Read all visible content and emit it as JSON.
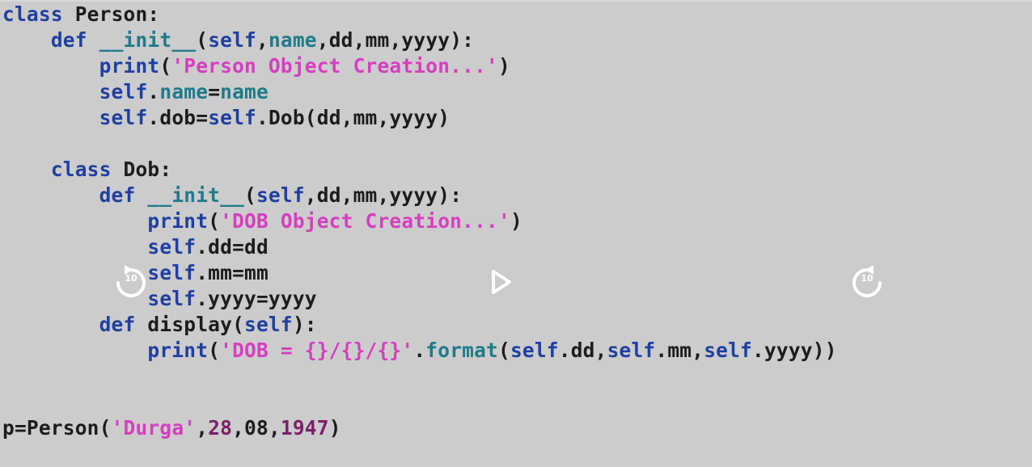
{
  "code_lines": [
    [
      {
        "t": "class",
        "c": "kw"
      },
      {
        "t": " Person:",
        "c": "plain"
      }
    ],
    [
      {
        "t": "    ",
        "c": "plain"
      },
      {
        "t": "def",
        "c": "kw"
      },
      {
        "t": " __init__",
        "c": "method"
      },
      {
        "t": "(",
        "c": "plain"
      },
      {
        "t": "self",
        "c": "selfkw"
      },
      {
        "t": ",",
        "c": "plain"
      },
      {
        "t": "name",
        "c": "attr"
      },
      {
        "t": ",dd,mm,yyyy):",
        "c": "plain"
      }
    ],
    [
      {
        "t": "        ",
        "c": "plain"
      },
      {
        "t": "print",
        "c": "selfkw"
      },
      {
        "t": "(",
        "c": "plain"
      },
      {
        "t": "'Person Object Creation...'",
        "c": "str"
      },
      {
        "t": ")",
        "c": "plain"
      }
    ],
    [
      {
        "t": "        ",
        "c": "plain"
      },
      {
        "t": "self",
        "c": "selfkw"
      },
      {
        "t": ".",
        "c": "plain"
      },
      {
        "t": "name",
        "c": "attr"
      },
      {
        "t": "=",
        "c": "plain"
      },
      {
        "t": "name",
        "c": "attr"
      }
    ],
    [
      {
        "t": "        ",
        "c": "plain"
      },
      {
        "t": "self",
        "c": "selfkw"
      },
      {
        "t": ".dob=",
        "c": "plain"
      },
      {
        "t": "self",
        "c": "selfkw"
      },
      {
        "t": ".Dob(dd,mm,yyyy)",
        "c": "plain"
      }
    ],
    [],
    [
      {
        "t": "    ",
        "c": "plain"
      },
      {
        "t": "class",
        "c": "kw"
      },
      {
        "t": " Dob:",
        "c": "plain"
      }
    ],
    [
      {
        "t": "        ",
        "c": "plain"
      },
      {
        "t": "def",
        "c": "kw"
      },
      {
        "t": " __init__",
        "c": "method"
      },
      {
        "t": "(",
        "c": "plain"
      },
      {
        "t": "self",
        "c": "selfkw"
      },
      {
        "t": ",dd,mm,yyyy):",
        "c": "plain"
      }
    ],
    [
      {
        "t": "            ",
        "c": "plain"
      },
      {
        "t": "print",
        "c": "selfkw"
      },
      {
        "t": "(",
        "c": "plain"
      },
      {
        "t": "'DOB Object Creation...'",
        "c": "str"
      },
      {
        "t": ")",
        "c": "plain"
      }
    ],
    [
      {
        "t": "            ",
        "c": "plain"
      },
      {
        "t": "self",
        "c": "selfkw"
      },
      {
        "t": ".dd=dd",
        "c": "plain"
      }
    ],
    [
      {
        "t": "            ",
        "c": "plain"
      },
      {
        "t": "self",
        "c": "selfkw"
      },
      {
        "t": ".mm=mm",
        "c": "plain"
      }
    ],
    [
      {
        "t": "            ",
        "c": "plain"
      },
      {
        "t": "self",
        "c": "selfkw"
      },
      {
        "t": ".yyyy=yyyy",
        "c": "plain"
      }
    ],
    [
      {
        "t": "        ",
        "c": "plain"
      },
      {
        "t": "def",
        "c": "kw"
      },
      {
        "t": " display(",
        "c": "plain"
      },
      {
        "t": "self",
        "c": "selfkw"
      },
      {
        "t": "):",
        "c": "plain"
      }
    ],
    [
      {
        "t": "            ",
        "c": "plain"
      },
      {
        "t": "print",
        "c": "selfkw"
      },
      {
        "t": "(",
        "c": "plain"
      },
      {
        "t": "'DOB = {}/{}/{}'",
        "c": "str"
      },
      {
        "t": ".",
        "c": "plain"
      },
      {
        "t": "format",
        "c": "method"
      },
      {
        "t": "(",
        "c": "plain"
      },
      {
        "t": "self",
        "c": "selfkw"
      },
      {
        "t": ".dd,",
        "c": "plain"
      },
      {
        "t": "self",
        "c": "selfkw"
      },
      {
        "t": ".mm,",
        "c": "plain"
      },
      {
        "t": "self",
        "c": "selfkw"
      },
      {
        "t": ".yyyy))",
        "c": "plain"
      }
    ],
    [],
    [],
    [
      {
        "t": "p=Person(",
        "c": "plain"
      },
      {
        "t": "'Durga'",
        "c": "str"
      },
      {
        "t": ",",
        "c": "plain"
      },
      {
        "t": "28",
        "c": "num"
      },
      {
        "t": ",",
        "c": "plain"
      },
      {
        "t": "08",
        "c": "plain"
      },
      {
        "t": ",",
        "c": "plain"
      },
      {
        "t": "1947",
        "c": "num"
      },
      {
        "t": ")",
        "c": "plain"
      }
    ]
  ],
  "controls": {
    "rewind_seconds": "10",
    "forward_seconds": "10"
  },
  "icons": {
    "rewind": "rewind-10-icon",
    "play": "play-icon",
    "forward": "forward-10-icon"
  },
  "colors": {
    "background": "#cccccc",
    "keyword": "#1f3fa0",
    "string": "#d63ec0",
    "attribute": "#1f7b8a",
    "number": "#7a1f6a",
    "text": "#1c1c1c",
    "control": "#ffffff"
  }
}
